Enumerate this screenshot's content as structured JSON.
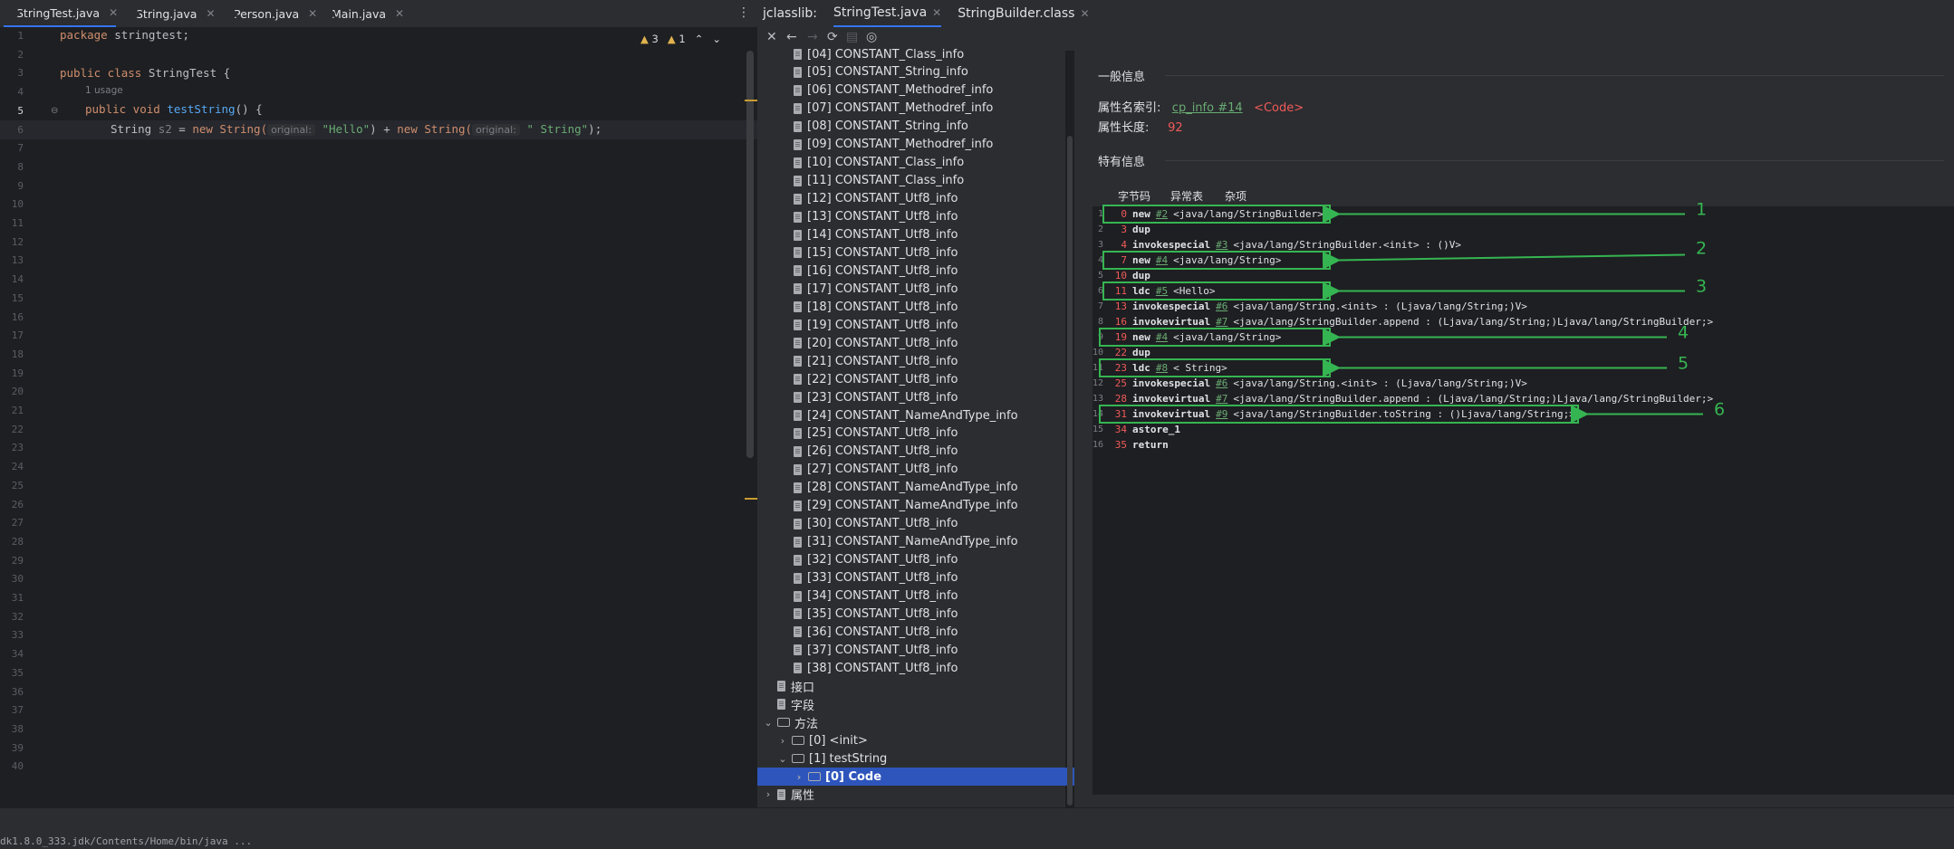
{
  "editor_tabs": [
    {
      "label": "StringTest.java",
      "active": true
    },
    {
      "label": "String.java",
      "active": false
    },
    {
      "label": "Person.java",
      "active": false
    },
    {
      "label": "Main.java",
      "active": false
    }
  ],
  "editor": {
    "warnings": "3",
    "weak_warnings": "1",
    "usage_hint": "1 usage",
    "line_numbers": [
      "1",
      "2",
      "3",
      "4",
      "5",
      "6",
      "7",
      "8",
      "9",
      "10",
      "11",
      "12",
      "13",
      "14",
      "15",
      "16",
      "17",
      "18",
      "19",
      "20",
      "21",
      "22",
      "23",
      "24",
      "25",
      "26",
      "27",
      "28",
      "29",
      "30",
      "31",
      "32",
      "33",
      "34",
      "35",
      "36",
      "37",
      "38",
      "39",
      "40"
    ],
    "code": {
      "l1_kw": "package",
      "l1_rest": " stringtest;",
      "l3_kw": "public class",
      "l3_rest": " StringTest {",
      "l4_kw": "public void",
      "l4_fn": "testString",
      "l4_rest": "() {",
      "l5_type": "String ",
      "l5_var": "s2",
      "l5_eq": " = ",
      "l5_new1": "new String(",
      "l5_hint1": "original:",
      "l5_str1": "\"Hello\"",
      "l5_mid": ") + ",
      "l5_new2": "new String(",
      "l5_hint2": "original:",
      "l5_str2": "\" String\"",
      "l5_end": ");"
    }
  },
  "jclasslib": {
    "label": "jclasslib:",
    "tabs": [
      {
        "label": "StringTest.java",
        "active": true
      },
      {
        "label": "StringBuilder.class",
        "active": false
      }
    ]
  },
  "tree": {
    "constants": [
      "[04] CONSTANT_Class_info",
      "[05] CONSTANT_String_info",
      "[06] CONSTANT_Methodref_info",
      "[07] CONSTANT_Methodref_info",
      "[08] CONSTANT_String_info",
      "[09] CONSTANT_Methodref_info",
      "[10] CONSTANT_Class_info",
      "[11] CONSTANT_Class_info",
      "[12] CONSTANT_Utf8_info",
      "[13] CONSTANT_Utf8_info",
      "[14] CONSTANT_Utf8_info",
      "[15] CONSTANT_Utf8_info",
      "[16] CONSTANT_Utf8_info",
      "[17] CONSTANT_Utf8_info",
      "[18] CONSTANT_Utf8_info",
      "[19] CONSTANT_Utf8_info",
      "[20] CONSTANT_Utf8_info",
      "[21] CONSTANT_Utf8_info",
      "[22] CONSTANT_Utf8_info",
      "[23] CONSTANT_Utf8_info",
      "[24] CONSTANT_NameAndType_info",
      "[25] CONSTANT_Utf8_info",
      "[26] CONSTANT_Utf8_info",
      "[27] CONSTANT_Utf8_info",
      "[28] CONSTANT_NameAndType_info",
      "[29] CONSTANT_NameAndType_info",
      "[30] CONSTANT_Utf8_info",
      "[31] CONSTANT_NameAndType_info",
      "[32] CONSTANT_Utf8_info",
      "[33] CONSTANT_Utf8_info",
      "[34] CONSTANT_Utf8_info",
      "[35] CONSTANT_Utf8_info",
      "[36] CONSTANT_Utf8_info",
      "[37] CONSTANT_Utf8_info",
      "[38] CONSTANT_Utf8_info"
    ],
    "interfaces": "接口",
    "fields": "字段",
    "methods": "方法",
    "method_init": "[0] <init>",
    "method_test": "[1] testString",
    "code_node": "[0] Code",
    "attributes": "属性"
  },
  "detail": {
    "general_title": "一般信息",
    "name_index_label": "属性名索引:",
    "name_index_link": "cp_info #14",
    "name_index_value": "<Code>",
    "length_label": "属性长度:",
    "length_value": "92",
    "specific_title": "特有信息",
    "subtabs": [
      "字节码",
      "异常表",
      "杂项"
    ]
  },
  "bytecode": [
    {
      "ln": "1",
      "off": "0",
      "op": "new",
      "ref": "#2",
      "arg": "<java/lang/StringBuilder>"
    },
    {
      "ln": "2",
      "off": "3",
      "op": "dup",
      "ref": "",
      "arg": ""
    },
    {
      "ln": "3",
      "off": "4",
      "op": "invokespecial",
      "ref": "#3",
      "arg": "<java/lang/StringBuilder.<init> : ()V>"
    },
    {
      "ln": "4",
      "off": "7",
      "op": "new",
      "ref": "#4",
      "arg": "<java/lang/String>"
    },
    {
      "ln": "5",
      "off": "10",
      "op": "dup",
      "ref": "",
      "arg": ""
    },
    {
      "ln": "6",
      "off": "11",
      "op": "ldc",
      "ref": "#5",
      "arg": "<Hello>"
    },
    {
      "ln": "7",
      "off": "13",
      "op": "invokespecial",
      "ref": "#6",
      "arg": "<java/lang/String.<init> : (Ljava/lang/String;)V>"
    },
    {
      "ln": "8",
      "off": "16",
      "op": "invokevirtual",
      "ref": "#7",
      "arg": "<java/lang/StringBuilder.append : (Ljava/lang/String;)Ljava/lang/StringBuilder;>"
    },
    {
      "ln": "9",
      "off": "19",
      "op": "new",
      "ref": "#4",
      "arg": "<java/lang/String>"
    },
    {
      "ln": "10",
      "off": "22",
      "op": "dup",
      "ref": "",
      "arg": ""
    },
    {
      "ln": "11",
      "off": "23",
      "op": "ldc",
      "ref": "#8",
      "arg": "< String>"
    },
    {
      "ln": "12",
      "off": "25",
      "op": "invokespecial",
      "ref": "#6",
      "arg": "<java/lang/String.<init> : (Ljava/lang/String;)V>"
    },
    {
      "ln": "13",
      "off": "28",
      "op": "invokevirtual",
      "ref": "#7",
      "arg": "<java/lang/StringBuilder.append : (Ljava/lang/String;)Ljava/lang/StringBuilder;>"
    },
    {
      "ln": "14",
      "off": "31",
      "op": "invokevirtual",
      "ref": "#9",
      "arg": "<java/lang/StringBuilder.toString : ()Ljava/lang/String;>"
    },
    {
      "ln": "15",
      "off": "34",
      "op": "astore_1",
      "ref": "",
      "arg": ""
    },
    {
      "ln": "16",
      "off": "35",
      "op": "return",
      "ref": "",
      "arg": ""
    }
  ],
  "annotations": [
    "1",
    "2",
    "3",
    "4",
    "5",
    "6"
  ],
  "status": {
    "path": "dk1.8.0_333.jdk/Contents/Home/bin/java ..."
  },
  "colors": {
    "accent": "#3574f0",
    "annotation": "#35b552",
    "offset": "#f05a5a",
    "link": "#6aab73"
  }
}
